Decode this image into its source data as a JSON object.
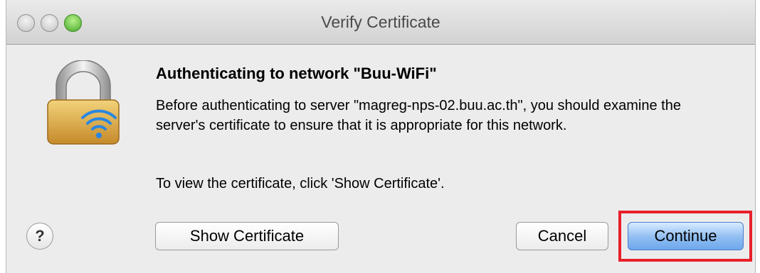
{
  "window": {
    "title": "Verify Certificate"
  },
  "dialog": {
    "heading": "Authenticating to network \"Buu-WiFi\"",
    "body": "Before authenticating to server \"magreg-nps-02.buu.ac.th\", you should examine the server's certificate to ensure that it is appropriate for this network.",
    "hint": "To view the certificate, click 'Show Certificate'.",
    "icon": "lock-wifi-icon"
  },
  "buttons": {
    "help_label": "?",
    "show_certificate_label": "Show Certificate",
    "cancel_label": "Cancel",
    "continue_label": "Continue"
  },
  "colors": {
    "highlight": "#e8202a",
    "default_button": "#6ea8ec"
  }
}
